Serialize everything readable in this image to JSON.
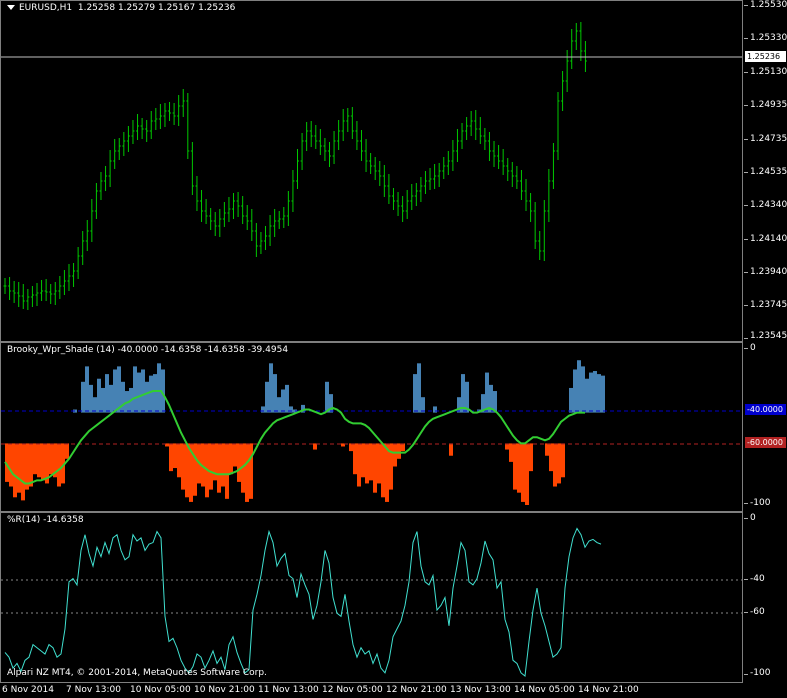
{
  "main": {
    "title": "EURUSD,H1",
    "ohlc": "1.25258 1.25279 1.25167 1.25236",
    "current_price": "1.25236",
    "price_ticks": [
      "1.25530",
      "1.25330",
      "1.25130",
      "1.24935",
      "1.24735",
      "1.24535",
      "1.24340",
      "1.24140",
      "1.23940",
      "1.23745",
      "1.23545"
    ]
  },
  "indicator1": {
    "title": "Brooky_Wpr_Shade (14) -40.0000 -14.6358 -14.6358 -39.4954",
    "ticks": [
      "0",
      "-100"
    ],
    "levels": [
      "-40.0000",
      "-60.0000"
    ],
    "colors": {
      "upper_shade": "#4682b4",
      "lower_shade": "#ff4500",
      "line": "#32cd32",
      "upper_level": "#0000cd",
      "lower_level": "#b22222"
    }
  },
  "indicator2": {
    "title": "%R(14) -14.6358",
    "ticks": [
      "0",
      "-40",
      "-60",
      "-100"
    ],
    "line_color": "#40e0d0"
  },
  "copyright": "Alpari NZ MT4, © 2001-2014, MetaQuotes Software Corp.",
  "time_axis": [
    "6 Nov 2014",
    "7 Nov 13:00",
    "10 Nov 05:00",
    "10 Nov 21:00",
    "11 Nov 13:00",
    "12 Nov 05:00",
    "12 Nov 21:00",
    "13 Nov 13:00",
    "14 Nov 05:00",
    "14 Nov 21:00"
  ],
  "wpr_values": [
    -85,
    -88,
    -95,
    -92,
    -97,
    -90,
    -88,
    -80,
    -82,
    -84,
    -86,
    -80,
    -82,
    -88,
    -86,
    -70,
    -40,
    -38,
    -42,
    -20,
    -10,
    -22,
    -30,
    -18,
    -24,
    -15,
    -22,
    -12,
    -10,
    -20,
    -26,
    -24,
    -10,
    -14,
    -12,
    -20,
    -16,
    -15,
    -8,
    -12,
    -62,
    -78,
    -76,
    -82,
    -90,
    -95,
    -98,
    -94,
    -86,
    -88,
    -95,
    -90,
    -84,
    -92,
    -88,
    -96,
    -80,
    -75,
    -85,
    -92,
    -98,
    -96,
    -58,
    -48,
    -36,
    -20,
    -8,
    -15,
    -30,
    -25,
    -22,
    -36,
    -38,
    -50,
    -35,
    -42,
    -48,
    -64,
    -55,
    -40,
    -20,
    -28,
    -50,
    -60,
    -62,
    -48,
    -65,
    -80,
    -88,
    -82,
    -86,
    -84,
    -92,
    -86,
    -95,
    -98,
    -90,
    -75,
    -70,
    -65,
    -55,
    -40,
    -15,
    -8,
    -30,
    -40,
    -42,
    -36,
    -58,
    -55,
    -50,
    -68,
    -44,
    -30,
    -15,
    -20,
    -40,
    -42,
    -38,
    -28,
    -14,
    -22,
    -26,
    -44,
    -40,
    -64,
    -72,
    -90,
    -92,
    -98,
    -100,
    -78,
    -58,
    -44,
    -60,
    -68,
    -78,
    -88,
    -86,
    -82,
    -44,
    -24,
    -12,
    -6,
    -10,
    -18,
    -14,
    -13,
    -15,
    -16
  ],
  "brooky_values": [
    -72,
    -76,
    -80,
    -82,
    -84,
    -86,
    -86,
    -85,
    -84,
    -84,
    -83,
    -82,
    -80,
    -78,
    -76,
    -73,
    -70,
    -66,
    -62,
    -58,
    -55,
    -52,
    -50,
    -48,
    -46,
    -44,
    -42,
    -40,
    -38,
    -36,
    -34,
    -33,
    -31,
    -30,
    -29,
    -28,
    -27,
    -26,
    -26,
    -26,
    -30,
    -35,
    -41,
    -47,
    -53,
    -58,
    -63,
    -67,
    -71,
    -74,
    -76,
    -78,
    -79,
    -80,
    -80,
    -80,
    -80,
    -79,
    -78,
    -76,
    -74,
    -71,
    -67,
    -62,
    -57,
    -53,
    -50,
    -47,
    -45,
    -44,
    -43,
    -42,
    -41,
    -40,
    -39,
    -38,
    -38,
    -39,
    -40,
    -41,
    -40,
    -38,
    -37,
    -38,
    -40,
    -44,
    -46,
    -47,
    -47,
    -47,
    -48,
    -50,
    -53,
    -56,
    -59,
    -62,
    -65,
    -66,
    -66,
    -66,
    -66,
    -64,
    -61,
    -57,
    -53,
    -49,
    -46,
    -44,
    -43,
    -42,
    -41,
    -40,
    -39,
    -38,
    -37,
    -37,
    -38,
    -40,
    -40,
    -39,
    -38,
    -37,
    -38,
    -40,
    -43,
    -47,
    -51,
    -55,
    -58,
    -60,
    -60,
    -58,
    -56,
    -56,
    -57,
    -58,
    -57,
    -54,
    -50,
    -46,
    -44,
    -42,
    -41,
    -40,
    -40,
    -40
  ]
}
